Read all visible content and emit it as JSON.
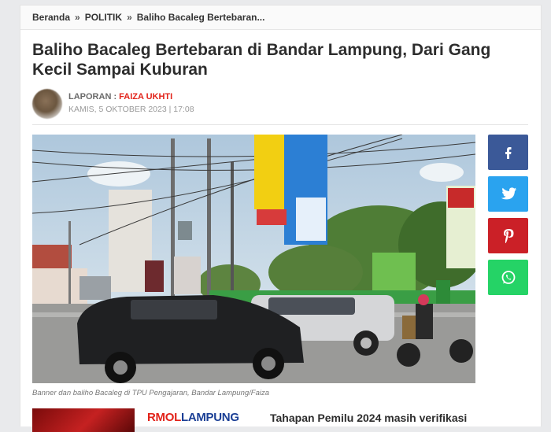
{
  "breadcrumb": {
    "home": "Beranda",
    "separator": "»",
    "category": "POLITIK",
    "current": "Baliho Bacaleg Bertebaran..."
  },
  "article": {
    "title": "Baliho Bacaleg Bertebaran di Bandar Lampung, Dari Gang Kecil Sampai Kuburan",
    "byline_label": "LAPORAN :",
    "author": "FAIZA UKHTI",
    "date": "KAMIS, 5 OKTOBER 2023 | 17:08",
    "caption": "Banner dan baliho Bacaleg di TPU Pengajaran, Bandar Lampung/Faiza"
  },
  "share": {
    "icons": [
      "facebook-icon",
      "twitter-icon",
      "pinterest-icon",
      "whatsapp-icon"
    ],
    "colors": {
      "facebook": "#3b5998",
      "twitter": "#2aa3ef",
      "pinterest": "#cb2027",
      "whatsapp": "#25d366"
    }
  },
  "related": {
    "logo_red": "RMOL",
    "logo_blue": "LAMPUNG",
    "text": "Tahapan Pemilu 2024 masih verifikasi"
  },
  "colors": {
    "accent_red": "#e2231a",
    "brand_blue": "#1b3f95"
  }
}
